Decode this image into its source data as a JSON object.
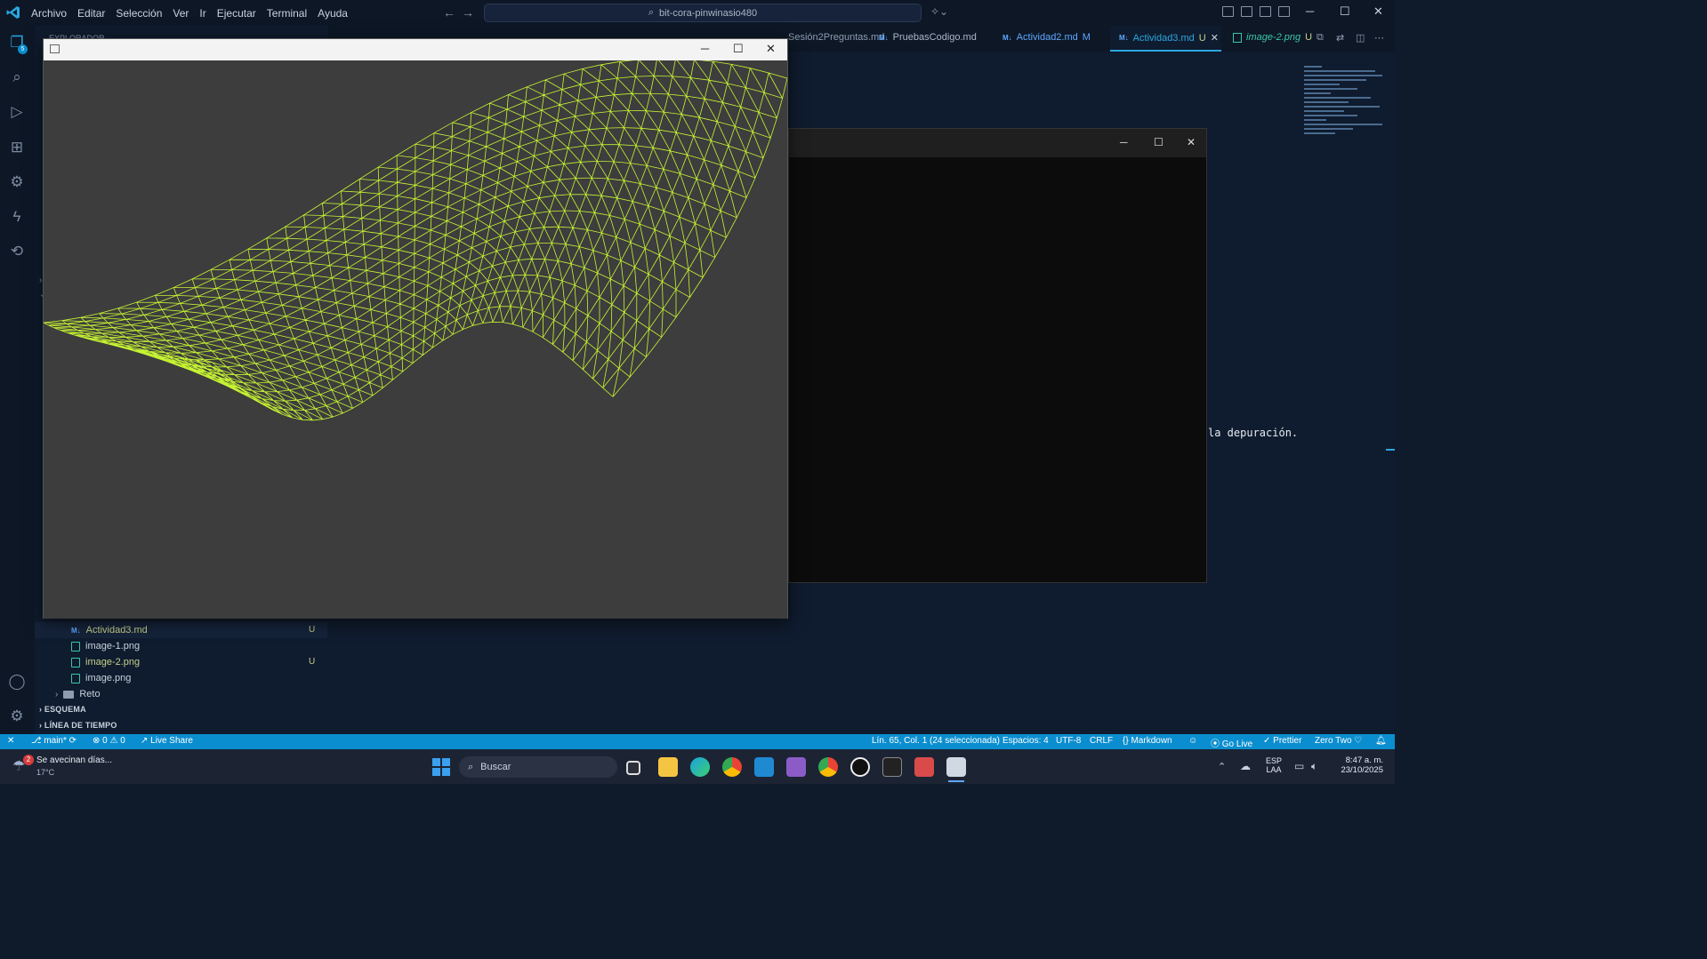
{
  "titlebar": {
    "menu": [
      "Archivo",
      "Editar",
      "Selección",
      "Ver",
      "Ir",
      "Ejecutar",
      "Terminal",
      "Ayuda"
    ],
    "command_center": "bit-cora-pinwinasio480"
  },
  "activity": {
    "explorer_badge": "5"
  },
  "sidebar": {
    "explorer_title": "EXPLORADOR",
    "files": [
      {
        "name": "Actividad3.md",
        "badge": "U"
      },
      {
        "name": "image-1.png",
        "badge": ""
      },
      {
        "name": "image-2.png",
        "badge": "U"
      },
      {
        "name": "image.png",
        "badge": ""
      }
    ],
    "folder_reto": "Reto",
    "section_outline": "ESQUEMA",
    "section_timeline": "LÍNEA DE TIEMPO"
  },
  "tabs": [
    {
      "label": "PruebasCodigo.md",
      "badge": ""
    },
    {
      "label": "Actividad2.md",
      "badge": "M"
    },
    {
      "label": "Actividad3.md",
      "badge": "U"
    },
    {
      "label": "image-2.png",
      "badge": "U"
    }
  ],
  "partial_tabs": [
    "Sesión2Preguntas.md"
  ],
  "editor": {
    "visible_text": "la depuración."
  },
  "statusbar": {
    "branch": "main*",
    "errors": "0",
    "warnings": "0",
    "live_share": "Live Share",
    "position": "Lín. 65, Col. 1 (24 seleccionada)",
    "spaces": "Espacios: 4",
    "encoding": "UTF-8",
    "eol": "CRLF",
    "language": "Markdown",
    "go_live": "Go Live",
    "prettier": "Prettier",
    "theme": "Zero Two"
  },
  "taskbar": {
    "weather_title": "Se avecinan días...",
    "weather_temp": "17°C",
    "weather_badge": "2",
    "search_placeholder": "Buscar",
    "lang_top": "ESP",
    "lang_bottom": "LAA",
    "time": "8:47 a. m.",
    "date": "23/10/2025"
  },
  "colors": {
    "mesh": "#c6f432",
    "accent": "#0b8ecf"
  }
}
